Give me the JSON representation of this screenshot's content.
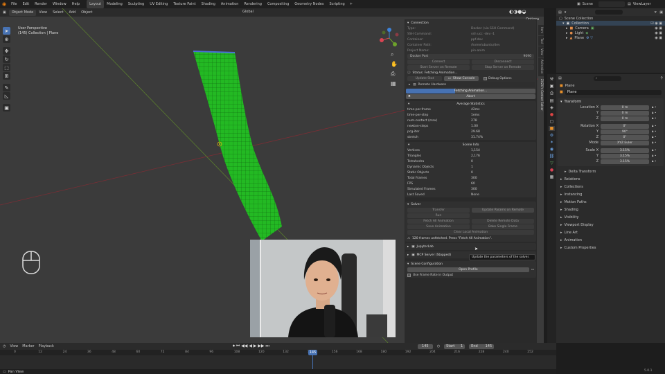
{
  "menu": [
    "File",
    "Edit",
    "Render",
    "Window",
    "Help"
  ],
  "workspaces": [
    "Layout",
    "Modeling",
    "Sculpting",
    "UV Editing",
    "Texture Paint",
    "Shading",
    "Animation",
    "Rendering",
    "Compositing",
    "Geometry Nodes",
    "Scripting"
  ],
  "scene_name": "Scene",
  "viewlayer_name": "ViewLayer",
  "viewport": {
    "mode": "Object Mode",
    "menus": [
      "View",
      "Select",
      "Add",
      "Object"
    ],
    "orientation": "Global",
    "persp": "User Perspective",
    "collection": "(145) Collection | Plane",
    "options": "Options"
  },
  "panel": {
    "connection": {
      "title": "Connection",
      "rows": [
        [
          "Type:",
          "Docker (via SSH Command)"
        ],
        [
          "SSH Command:",
          "ssh ucc -dev -1"
        ],
        [
          "Container:",
          "ppf-dev"
        ],
        [
          "Container Path:",
          "/home/ubuntu/dev"
        ],
        [
          "Project Name:",
          "pin-anim"
        ]
      ],
      "docker_port": "Docker Port",
      "docker_port_val": "9090",
      "connect": "Connect",
      "disconnect": "Disconnect",
      "start_server": "Start Server on Remote",
      "stop_server": "Stop Server on Remote",
      "status": "Status: Fetching Animation...",
      "update_status": "Update Stat",
      "show_console": "Show Console",
      "debug_options": "Debug Options",
      "remote_hardware": "Remote Hardware",
      "progress_label": "Fetching Animation...",
      "progress": 0.38,
      "abort": "Abort"
    },
    "avg": {
      "title": "Average Statistics",
      "rows": [
        [
          "time-per-frame",
          "42ms"
        ],
        [
          "time-per-step",
          "1ems"
        ],
        [
          "num-contact (max)",
          "278"
        ],
        [
          "newton-steps",
          "1.00"
        ],
        [
          "pcg-iter",
          "29.68"
        ],
        [
          "stretch",
          "31.74%"
        ]
      ]
    },
    "scene_info": {
      "title": "Scene Info",
      "rows": [
        [
          "Vertices",
          "1,154"
        ],
        [
          "Triangles",
          "2,176"
        ],
        [
          "Tetrahedra",
          "0"
        ],
        [
          "Dynamic Objects",
          "1"
        ],
        [
          "Static Objects",
          "0"
        ],
        [
          "Total Frames",
          "300"
        ],
        [
          "FPS",
          "60"
        ],
        [
          "Simulated Frames",
          "300"
        ],
        [
          "Last Saved",
          "None"
        ]
      ]
    },
    "solver": {
      "title": "Solver",
      "transfer": "Transfer",
      "update_params": "Update Params on Remote",
      "run": "Run",
      "tooltip": "Update the parameters of the solver.",
      "fetch_all": "Fetch All Animation",
      "delete_remote": "Delete Remote Data",
      "save_anim": "Save Animation",
      "bake_single": "Bake Single Frame",
      "clear_local": "Clear Local Animation",
      "warning": "120 frames unfetched. Press \"Fetch All Animation\"."
    },
    "jupyter": "JupyterLab",
    "mcp": "MCP Server (Stopped)",
    "scene_config": {
      "title": "Scene Configuration",
      "open_profile": "Open Profile",
      "use_frame_rate": "Use Frame Rate in Output"
    }
  },
  "side_tabs": [
    "Item",
    "Tool",
    "View",
    "Animation",
    "ZOZO's Contact Solver"
  ],
  "outliner": {
    "title": "Scene Collection",
    "items": [
      {
        "label": "Collection",
        "depth": 1
      },
      {
        "label": "Camera",
        "depth": 2
      },
      {
        "label": "Light",
        "depth": 2
      },
      {
        "label": "Plane",
        "depth": 2
      }
    ]
  },
  "props": {
    "object": "Plane",
    "object2": "Plane",
    "transform": "Transform",
    "loc_label": "Location X",
    "loc": [
      "0 m",
      "0 m",
      "0 m"
    ],
    "rot_label": "Rotation X",
    "rot": [
      "0°",
      "90°",
      "0°"
    ],
    "mode_label": "Mode",
    "mode": "XYZ Euler",
    "scale_label": "Scale X",
    "scale": [
      "3.15%",
      "3.15%",
      "3.15%"
    ],
    "axis_y": "Y",
    "axis_z": "Z",
    "sections": [
      "Delta Transform",
      "Relations",
      "Collections",
      "Instancing",
      "Motion Paths",
      "Shading",
      "Visibility",
      "Viewport Display",
      "Line Art",
      "Animation",
      "Custom Properties"
    ]
  },
  "timeline": {
    "menus": [
      "View",
      "Marker",
      "Playback"
    ],
    "current": "145",
    "start_label": "Start",
    "start": "1",
    "end_label": "End",
    "end": "145",
    "ticks": [
      "0",
      "12",
      "24",
      "36",
      "48",
      "60",
      "72",
      "84",
      "96",
      "108",
      "120",
      "132",
      "144",
      "156",
      "168",
      "180",
      "192",
      "204",
      "216",
      "228",
      "240",
      "252"
    ]
  },
  "status_bar": "Pan View",
  "version": "5.0.1"
}
